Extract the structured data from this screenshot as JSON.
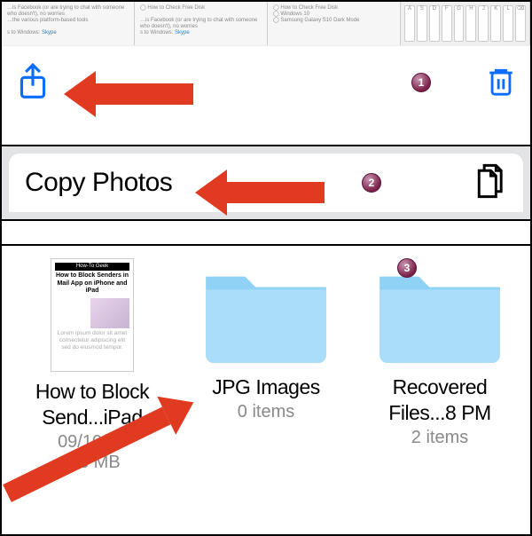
{
  "step1": {
    "thumbs": {
      "link_label": "Skype",
      "line1": "…is Facebook (or are trying to chat with someone who doesn't), no worries",
      "line2": "…the various platform-based tools",
      "btow": "s to Windows:",
      "howto": "How to Check Free Disk",
      "win10": "Windows 10",
      "samsung": "Samsung Galaxy S10 Dark Mode"
    },
    "keyboard_keys": [
      "A",
      "S",
      "D",
      "F",
      "G",
      "H",
      "J",
      "K",
      "L",
      "⌫"
    ]
  },
  "step2": {
    "copy_label": "Copy Photos"
  },
  "step3": {
    "items": [
      {
        "name_line1": "How to Block",
        "name_line2": "Send...iPad",
        "sub1": "09/10/19",
        "sub2": "1.3 MB"
      },
      {
        "name_line1": "JPG Images",
        "name_line2": "",
        "sub1": "0 items",
        "sub2": ""
      },
      {
        "name_line1": "Recovered",
        "name_line2": "Files...8 PM",
        "sub1": "2 items",
        "sub2": ""
      }
    ],
    "doc_thumb": {
      "brand": "How-To Geek",
      "headline": "How to Block Senders in Mail App on iPhone and iPad"
    }
  },
  "badges": {
    "one": "1",
    "two": "2",
    "three": "3"
  }
}
